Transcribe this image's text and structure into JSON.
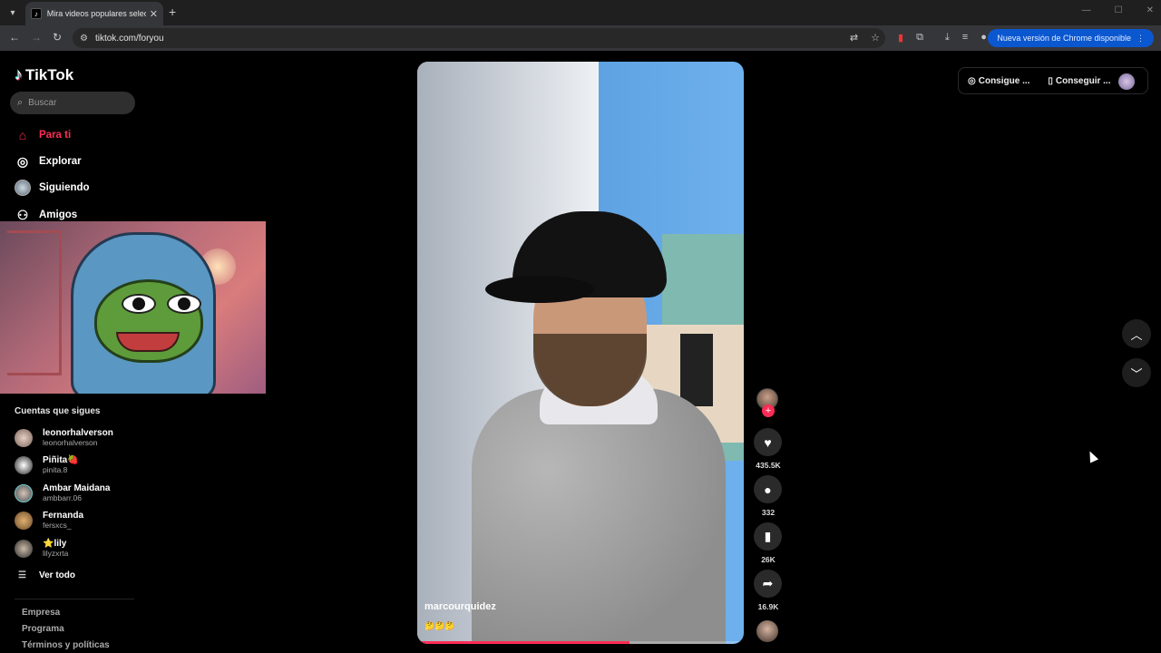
{
  "browser": {
    "tab_title": "Mira videos populares seleccio",
    "url": "tiktok.com/foryou",
    "update_button": "Nueva versión de Chrome disponible"
  },
  "sidebar": {
    "logo": "TikTok",
    "search_placeholder": "Buscar",
    "nav": [
      {
        "label": "Para ti",
        "icon": "home-icon",
        "active": true
      },
      {
        "label": "Explorar",
        "icon": "compass-icon"
      },
      {
        "label": "Siguiendo",
        "icon": "following-avatar-icon"
      },
      {
        "label": "Amigos",
        "icon": "friends-icon"
      }
    ],
    "following_title": "Cuentas que sigues",
    "accounts": [
      {
        "name": "leonorhalverson",
        "handle": "leonorhalverson"
      },
      {
        "name": "Piñita🍓",
        "handle": "pinita.8"
      },
      {
        "name": "Ambar Maidana",
        "handle": "ambbarr.06"
      },
      {
        "name": "Fernanda",
        "handle": "fersxcs_"
      },
      {
        "name": "⭐lily",
        "handle": "lilyzxrta"
      }
    ],
    "see_all": "Ver todo",
    "footer": [
      "Empresa",
      "Programa",
      "Términos y políticas"
    ]
  },
  "video": {
    "username": "marcourquidez",
    "caption_emojis": "🤔🤔🤔",
    "progress": 0.65
  },
  "actions": {
    "likes": "435.5K",
    "comments": "332",
    "saves": "26K",
    "shares": "16.9K"
  },
  "top_right": {
    "coins_label": "Consigue ...",
    "app_label": "Conseguir ..."
  },
  "colors": {
    "accent": "#fe2c55",
    "chrome_update": "#0b57d0"
  }
}
